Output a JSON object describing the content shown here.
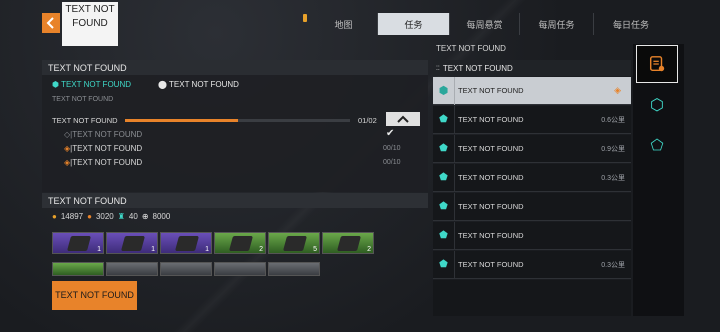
{
  "header": {
    "title": "TEXT NOT FOUND",
    "tabs": [
      {
        "label": "地图",
        "active": false
      },
      {
        "label": "任务",
        "active": true
      },
      {
        "label": "每周悬赏",
        "active": false
      },
      {
        "label": "每周任务",
        "active": false
      },
      {
        "label": "每日任务",
        "active": false
      }
    ]
  },
  "quest": {
    "section_title": "TEXT NOT FOUND",
    "type_label": "TEXT NOT FOUND",
    "location_label": "TEXT NOT FOUND",
    "description": "TEXT NOT FOUND",
    "progress_label": "TEXT NOT FOUND",
    "progress_value": "01/02",
    "progress_fraction": 0.5,
    "objectives": [
      {
        "text": "TEXT NOT FOUND",
        "status": "done",
        "count": ""
      },
      {
        "text": "TEXT NOT FOUND",
        "status": "active",
        "count": "00/10"
      },
      {
        "text": "TEXT NOT FOUND",
        "status": "active",
        "count": "00/10"
      }
    ]
  },
  "rewards": {
    "section_title": "TEXT NOT FOUND",
    "currencies": [
      {
        "icon": "xp-icon",
        "value": "14897"
      },
      {
        "icon": "sp-icon",
        "value": "3020"
      },
      {
        "icon": "crest-icon",
        "value": "40"
      },
      {
        "icon": "coin-icon",
        "value": "8000"
      }
    ],
    "items_row1": [
      {
        "rarity": "purple",
        "count": "1"
      },
      {
        "rarity": "purple",
        "count": "1"
      },
      {
        "rarity": "purple",
        "count": "1"
      },
      {
        "rarity": "green",
        "count": "2"
      },
      {
        "rarity": "green",
        "count": "5"
      },
      {
        "rarity": "green",
        "count": "2"
      }
    ],
    "items_row2": [
      {
        "rarity": "green",
        "count": ""
      },
      {
        "rarity": "grey",
        "count": ""
      },
      {
        "rarity": "grey",
        "count": ""
      },
      {
        "rarity": "grey",
        "count": ""
      },
      {
        "rarity": "grey",
        "count": ""
      }
    ],
    "action_label": "TEXT NOT FOUND"
  },
  "quest_list": {
    "header": "TEXT NOT FOUND",
    "sub_header": "TEXT NOT FOUND",
    "items": [
      {
        "label": "TEXT NOT FOUND",
        "distance": "",
        "selected": true
      },
      {
        "label": "TEXT NOT FOUND",
        "distance": "0.6公里",
        "selected": false
      },
      {
        "label": "TEXT NOT FOUND",
        "distance": "0.9公里",
        "selected": false
      },
      {
        "label": "TEXT NOT FOUND",
        "distance": "0.3公里",
        "selected": false
      },
      {
        "label": "TEXT NOT FOUND",
        "distance": "",
        "selected": false
      },
      {
        "label": "TEXT NOT FOUND",
        "distance": "",
        "selected": false
      },
      {
        "label": "TEXT NOT FOUND",
        "distance": "0.3公里",
        "selected": false
      }
    ]
  },
  "colors": {
    "accent": "#e8832a",
    "cyan": "#3fd8c8"
  }
}
